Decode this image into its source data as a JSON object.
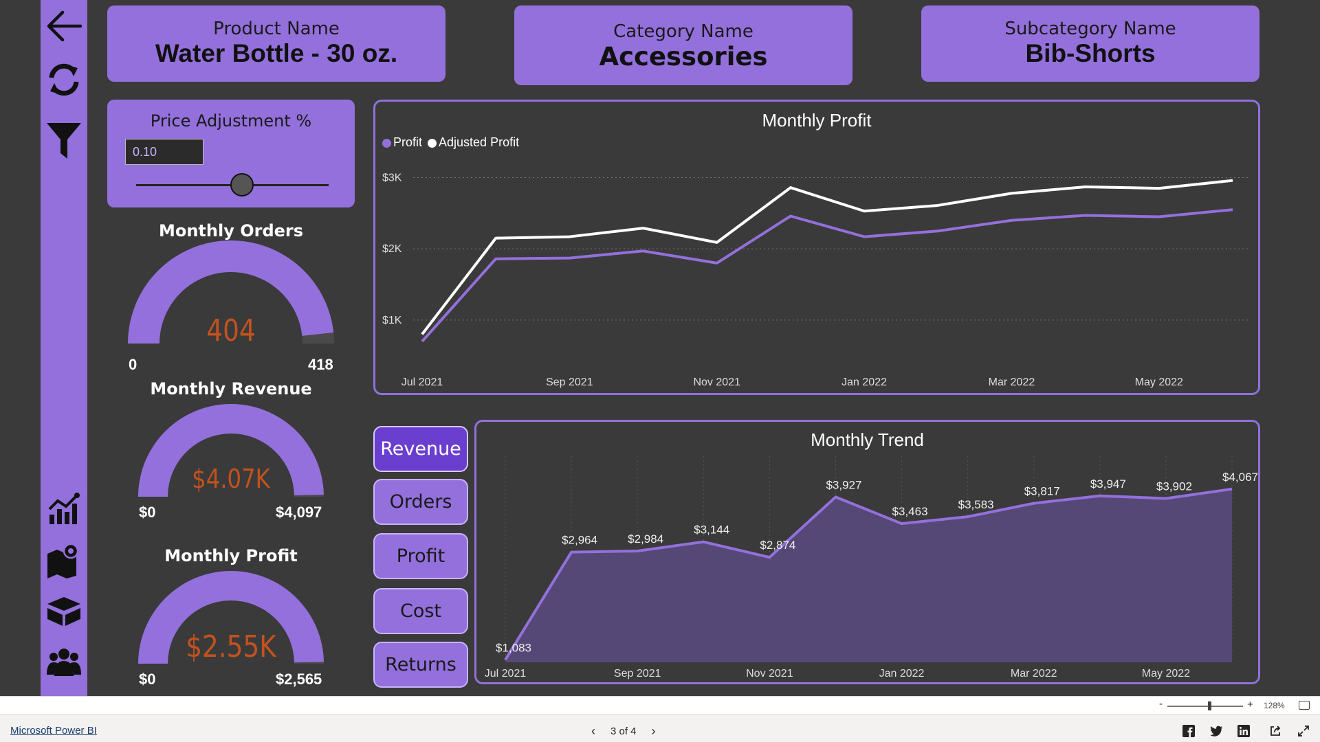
{
  "cards": {
    "product": {
      "label": "Product Name",
      "value": "Water Bottle - 30 oz."
    },
    "category": {
      "label": "Category Name",
      "value": "Accessories"
    },
    "subcategory": {
      "label": "Subcategory Name",
      "value": "Bib-Shorts"
    }
  },
  "price_adjustment": {
    "label": "Price Adjustment %",
    "value": "0.10",
    "slider_fraction": 0.55
  },
  "gauges": [
    {
      "title": "Monthly Orders",
      "value": "404",
      "min": "0",
      "max": "418",
      "fraction": 0.966
    },
    {
      "title": "Monthly Revenue",
      "value": "$4.07K",
      "min": "$0",
      "max": "$4,097",
      "fraction": 0.993
    },
    {
      "title": "Monthly Profit",
      "value": "$2.55K",
      "min": "$0",
      "max": "$2,565",
      "fraction": 0.994
    }
  ],
  "buttons": [
    {
      "label": "Revenue",
      "active": true
    },
    {
      "label": "Orders",
      "active": false
    },
    {
      "label": "Profit",
      "active": false
    },
    {
      "label": "Cost",
      "active": false
    },
    {
      "label": "Returns",
      "active": false
    }
  ],
  "colors": {
    "accent": "#9370db",
    "active_button": "#6a3fcf",
    "background": "#3a3a3a",
    "gauge_value": "#c2521e",
    "adjusted_line": "#ffffff"
  },
  "sidebar_icons": [
    "back-arrow-icon",
    "refresh-icon",
    "filter-icon",
    "chart-icon",
    "map-icon",
    "box-icon",
    "users-icon"
  ],
  "chart_data": [
    {
      "type": "line",
      "title": "Monthly Profit",
      "x": [
        "Jul 2021",
        "Aug 2021",
        "Sep 2021",
        "Oct 2021",
        "Nov 2021",
        "Dec 2021",
        "Jan 2022",
        "Feb 2022",
        "Mar 2022",
        "Apr 2022",
        "May 2022",
        "Jun 2022"
      ],
      "x_tick_labels": [
        "Jul 2021",
        "Sep 2021",
        "Nov 2021",
        "Jan 2022",
        "Mar 2022",
        "May 2022"
      ],
      "y_tick_labels": [
        "$3K",
        "$2K",
        "$1K"
      ],
      "y_ticks": [
        3000,
        2000,
        1000
      ],
      "ylim": [
        400,
        3150
      ],
      "grid": "horizontal dotted",
      "legend": "top-left",
      "series": [
        {
          "name": "Profit",
          "color": "#9370db",
          "values": [
            700,
            1860,
            1870,
            1970,
            1800,
            2460,
            2170,
            2250,
            2400,
            2470,
            2450,
            2550
          ]
        },
        {
          "name": "Adjusted Profit",
          "color": "#ffffff",
          "values": [
            800,
            2150,
            2170,
            2290,
            2090,
            2860,
            2530,
            2610,
            2780,
            2870,
            2850,
            2960
          ]
        }
      ]
    },
    {
      "type": "area",
      "title": "Monthly Trend",
      "x": [
        "Jul 2021",
        "Aug 2021",
        "Sep 2021",
        "Oct 2021",
        "Nov 2021",
        "Dec 2021",
        "Jan 2022",
        "Feb 2022",
        "Mar 2022",
        "Apr 2022",
        "May 2022",
        "Jun 2022"
      ],
      "x_tick_labels": [
        "Jul 2021",
        "Sep 2021",
        "Nov 2021",
        "Jan 2022",
        "Mar 2022",
        "May 2022"
      ],
      "values": [
        1083,
        2964,
        2984,
        3144,
        2874,
        3927,
        3463,
        3583,
        3817,
        3947,
        3902,
        4067
      ],
      "data_labels": [
        "$1,083",
        "$2,964",
        "$2,984",
        "$3,144",
        "$2,874",
        "$3,927",
        "$3,463",
        "$3,583",
        "$3,817",
        "$3,947",
        "$3,902",
        "$4,067"
      ],
      "ylim": [
        800,
        4700
      ],
      "grid": "vertical dotted"
    }
  ],
  "footer": {
    "brand_link": "Microsoft Power BI",
    "page_indicator": "3 of 4",
    "zoom_level": "128%",
    "zoom_minus": "-",
    "zoom_plus": "+",
    "zoom_fraction": 0.55
  }
}
